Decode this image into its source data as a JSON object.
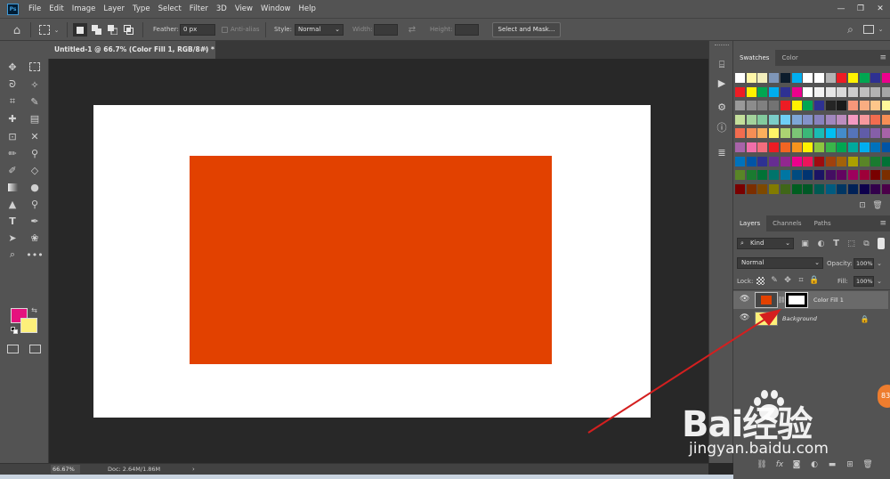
{
  "app": {
    "logo": "Ps"
  },
  "menu": [
    "File",
    "Edit",
    "Image",
    "Layer",
    "Type",
    "Select",
    "Filter",
    "3D",
    "View",
    "Window",
    "Help"
  ],
  "window_controls": {
    "minimize": "—",
    "restore": "❐",
    "close": "✕"
  },
  "options_bar": {
    "feather_label": "Feather:",
    "feather_value": "0 px",
    "antialias_label": "Anti-alias",
    "style_label": "Style:",
    "style_value": "Normal",
    "width_label": "Width:",
    "height_label": "Height:",
    "select_mask_label": "Select and Mask..."
  },
  "document": {
    "tab_title": "Untitled-1 @ 66.7% (Color Fill 1, RGB/8#) *",
    "fill_color": "#e24100"
  },
  "status_bar": {
    "zoom": "66.67%",
    "doc_info": "Doc: 2.64M/1.86M",
    "arrow": "›"
  },
  "tools": {
    "foreground_color": "#e5117e",
    "background_color": "#fdf07a"
  },
  "swatches_panel": {
    "tabs": [
      "Swatches",
      "Color"
    ]
  },
  "layers_panel": {
    "tabs": [
      "Layers",
      "Channels",
      "Paths"
    ],
    "kind_label": "Kind",
    "blend_mode": "Normal",
    "opacity_label": "Opacity:",
    "opacity_value": "100%",
    "lock_label": "Lock:",
    "fill_label": "Fill:",
    "fill_value": "100%",
    "layers": [
      {
        "name": "Color Fill 1",
        "selected": true
      },
      {
        "name": "Background",
        "locked": true
      }
    ]
  },
  "watermark": {
    "brand": "Bai经验",
    "url": "jingyan.baidu.com"
  },
  "badge": "83"
}
